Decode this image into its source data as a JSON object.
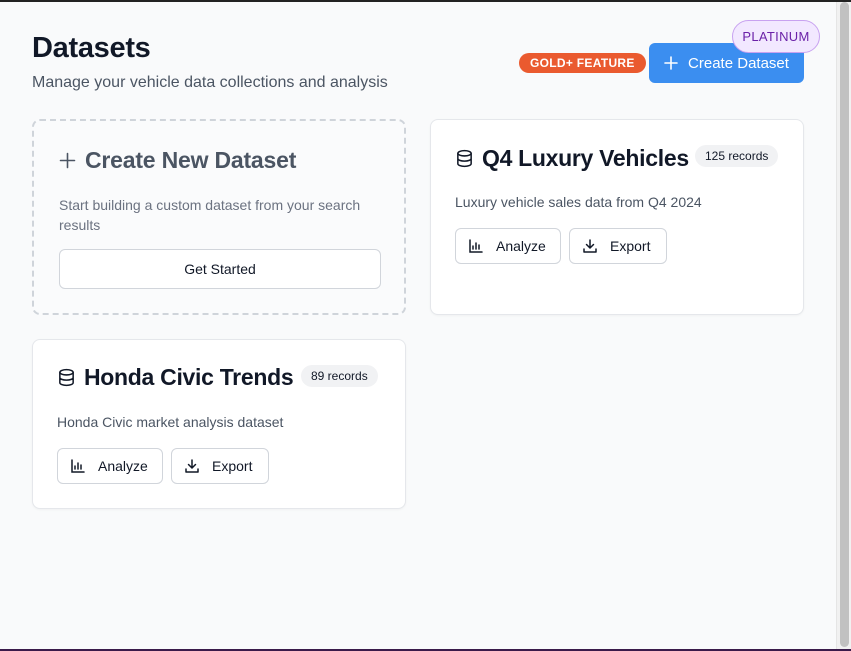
{
  "header": {
    "title": "Datasets",
    "subtitle": "Manage your vehicle data collections and analysis",
    "gold_badge": "GOLD+ FEATURE",
    "create_button": "Create Dataset",
    "tier_badge": "PLATINUM"
  },
  "new_card": {
    "title": "Create New Dataset",
    "description": "Start building a custom dataset from your search results",
    "button": "Get Started"
  },
  "datasets": [
    {
      "title": "Q4 Luxury Vehicles",
      "records": "125 records",
      "description": "Luxury vehicle sales data from Q4 2024",
      "analyze": "Analyze",
      "export": "Export"
    },
    {
      "title": "Honda Civic Trends",
      "records": "89 records",
      "description": "Honda Civic market analysis dataset",
      "analyze": "Analyze",
      "export": "Export"
    }
  ],
  "colors": {
    "primary": "#3b8ef0",
    "gold_badge": "#ea5a2f",
    "platinum_bg": "#f2e8ff",
    "platinum_text": "#6b21a8"
  },
  "icons": {
    "plus": "plus-icon",
    "database": "database-icon",
    "chart": "bar-chart-icon",
    "download": "download-icon"
  }
}
